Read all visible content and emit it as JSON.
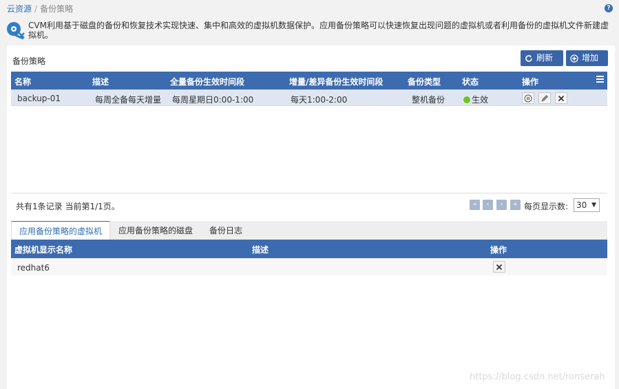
{
  "breadcrumb": {
    "root": "云资源",
    "separator": "/",
    "current": "备份策略"
  },
  "info": {
    "text": "CVM利用基于磁盘的备份和恢复技术实现快速、集中和高效的虚拟机数据保护。应用备份策略可以快速恢复出现问题的虚拟机或者利用备份的虚拟机文件新建虚拟机。"
  },
  "panel": {
    "title": "备份策略",
    "refresh_label": "刷新",
    "add_label": "增加"
  },
  "policy_table": {
    "columns": [
      "名称",
      "描述",
      "全量备份生效时间段",
      "增量/差异备份生效时间段",
      "备份类型",
      "状态",
      "操作"
    ],
    "rows": [
      {
        "name": "backup-01",
        "desc": "每周全备每天增量",
        "full": "每周星期日0:00-1:00",
        "incr": "每天1:00-2:00",
        "type": "整机备份",
        "status": "生效",
        "status_color": "#6cc520"
      }
    ]
  },
  "pager": {
    "summary": "共有1条记录 当前第1/1页。",
    "per_page_label": "每页显示数:",
    "per_page_value": "30"
  },
  "tabs": [
    "应用备份策略的虚拟机",
    "应用备份策略的磁盘",
    "备份日志"
  ],
  "vm_table": {
    "columns": [
      "虚拟机显示名称",
      "描述",
      "操作"
    ],
    "rows": [
      {
        "name": "redhat6",
        "desc": ""
      }
    ]
  },
  "watermark": "https://blog.csdn.net/ronserah",
  "colors": {
    "header": "#3d6baf",
    "button": "#3a64a8",
    "link": "#2f6fb5"
  }
}
